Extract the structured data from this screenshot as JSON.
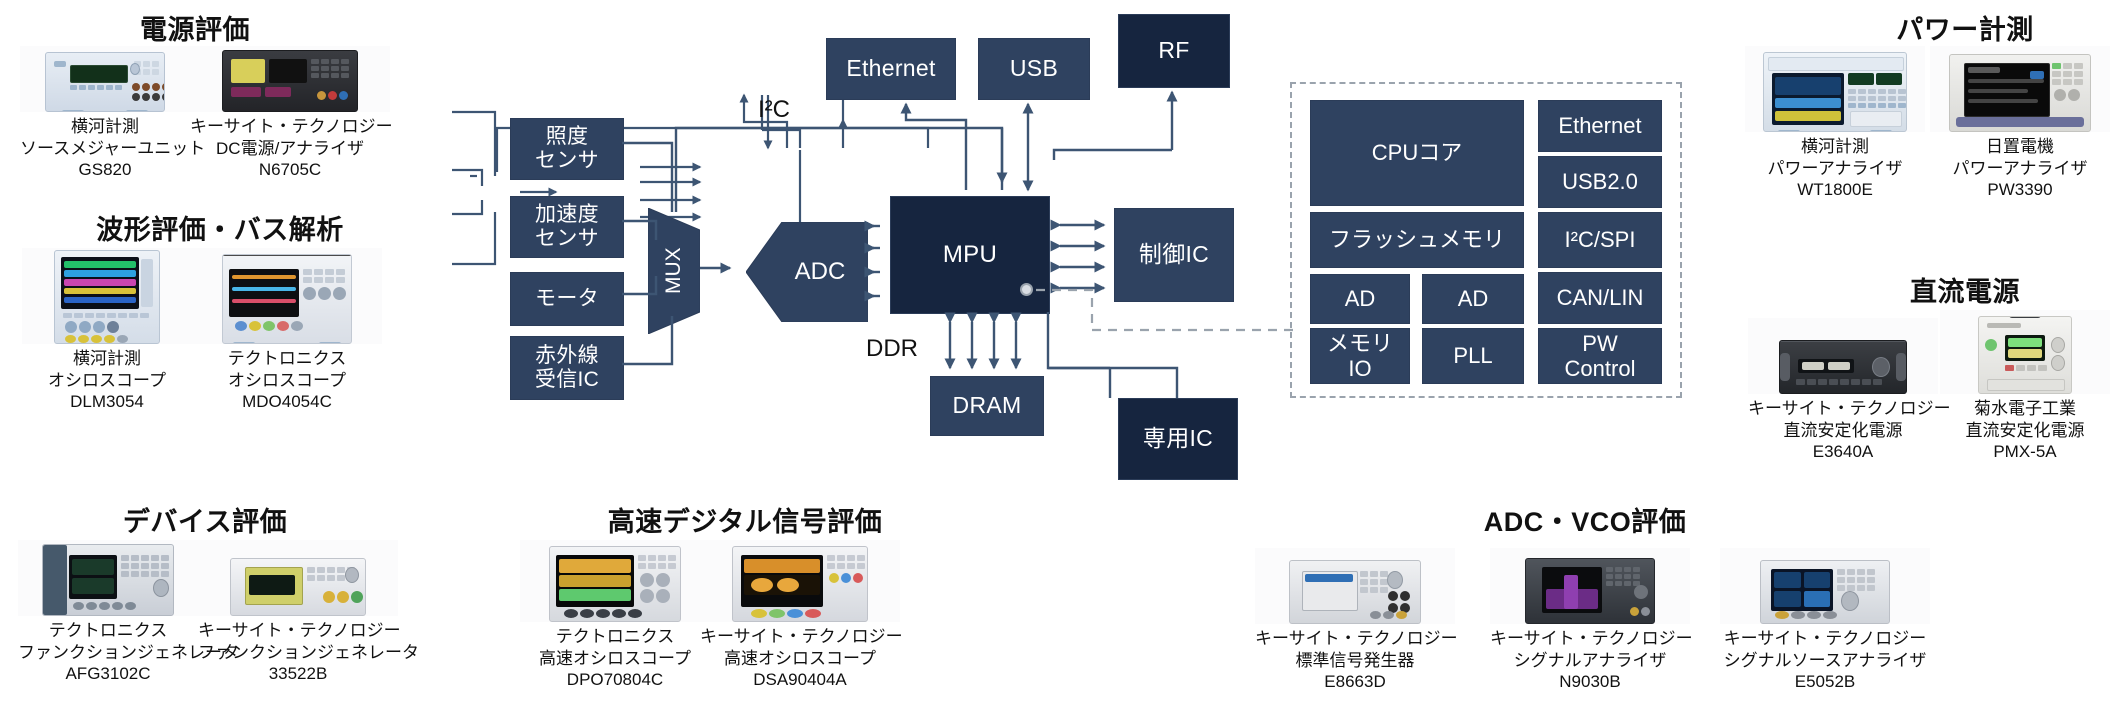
{
  "sections": [
    {
      "id": "power-eval",
      "title": "電源評価",
      "instruments": [
        {
          "brand": "横河計測",
          "type": "ソースメジャーユニット",
          "model": "GS820"
        },
        {
          "brand": "キーサイト・テクノロジー",
          "type": "DC電源/アナライザ",
          "model": "N6705C"
        }
      ]
    },
    {
      "id": "waveform-bus",
      "title": "波形評価・バス解析",
      "instruments": [
        {
          "brand": "横河計測",
          "type": "オシロスコープ",
          "model": "DLM3054"
        },
        {
          "brand": "テクトロニクス",
          "type": "オシロスコープ",
          "model": "MDO4054C"
        }
      ]
    },
    {
      "id": "device-eval",
      "title": "デバイス評価",
      "instruments": [
        {
          "brand": "テクトロニクス",
          "type": "ファンクションジェネレータ",
          "model": "AFG3102C"
        },
        {
          "brand": "キーサイト・テクノロジー",
          "type": "ファンクションジェネレータ",
          "model": "33522B"
        }
      ]
    },
    {
      "id": "highspeed-digital",
      "title": "高速デジタル信号評価",
      "instruments": [
        {
          "brand": "テクトロニクス",
          "type": "高速オシロスコープ",
          "model": "DPO70804C"
        },
        {
          "brand": "キーサイト・テクノロジー",
          "type": "高速オシロスコープ",
          "model": "DSA90404A"
        }
      ]
    },
    {
      "id": "adc-vco",
      "title": "ADC・VCO評価",
      "instruments": [
        {
          "brand": "キーサイト・テクノロジー",
          "type": "標準信号発生器",
          "model": "E8663D"
        },
        {
          "brand": "キーサイト・テクノロジー",
          "type": "シグナルアナライザ",
          "model": "N9030B"
        },
        {
          "brand": "キーサイト・テクノロジー",
          "type": "シグナルソースアナライザ",
          "model": "E5052B"
        }
      ]
    },
    {
      "id": "power-measure",
      "title": "パワー計測",
      "instruments": [
        {
          "brand": "横河計測",
          "type": "パワーアナライザ",
          "model": "WT1800E"
        },
        {
          "brand": "日置電機",
          "type": "パワーアナライザ",
          "model": "PW3390"
        }
      ]
    },
    {
      "id": "dc-power",
      "title": "直流電源",
      "instruments": [
        {
          "brand": "キーサイト・テクノロジー",
          "type": "直流安定化電源",
          "model": "E3640A"
        },
        {
          "brand": "菊水電子工業",
          "type": "直流安定化電源",
          "model": "PMX-5A"
        }
      ]
    }
  ],
  "diagram": {
    "sensors": [
      {
        "id": "illuminance",
        "label": "照度\nセンサ"
      },
      {
        "id": "accel",
        "label": "加速度\nセンサ"
      },
      {
        "id": "motor",
        "label": "モータ"
      },
      {
        "id": "ir-receiver",
        "label": "赤外線\n受信IC"
      }
    ],
    "mux_label": "MUX",
    "adc_label": "ADC",
    "mpu_label": "MPU",
    "peripherals": [
      {
        "id": "ethernet",
        "label": "Ethernet"
      },
      {
        "id": "usb",
        "label": "USB"
      },
      {
        "id": "rf",
        "label": "RF"
      },
      {
        "id": "control-ic",
        "label": "制御IC"
      },
      {
        "id": "dram",
        "label": "DRAM"
      },
      {
        "id": "dedicated-ic",
        "label": "専用IC"
      }
    ],
    "bus_labels": [
      {
        "id": "i2c",
        "label": "I²C"
      },
      {
        "id": "ddr",
        "label": "DDR"
      }
    ],
    "soc": {
      "blocks": [
        {
          "id": "cpu-core",
          "label": "CPUコア"
        },
        {
          "id": "flash-memory",
          "label": "フラッシュメモリ"
        },
        {
          "id": "ad-1",
          "label": "AD"
        },
        {
          "id": "ad-2",
          "label": "AD"
        },
        {
          "id": "memory-io",
          "label": "メモリ\nIO"
        },
        {
          "id": "pll",
          "label": "PLL"
        },
        {
          "id": "soc-ethernet",
          "label": "Ethernet"
        },
        {
          "id": "usb20",
          "label": "USB2.0"
        },
        {
          "id": "i2c-spi",
          "label": "I²C/SPI"
        },
        {
          "id": "can-lin",
          "label": "CAN/LIN"
        },
        {
          "id": "pw-control",
          "label": "PW\nControl"
        }
      ]
    }
  },
  "colors": {
    "block_fill": "#2f4260",
    "block_fill_dark": "#16253f",
    "wire": "#3d5573",
    "soc_border": "#9aa3ad",
    "text": "#111111"
  }
}
